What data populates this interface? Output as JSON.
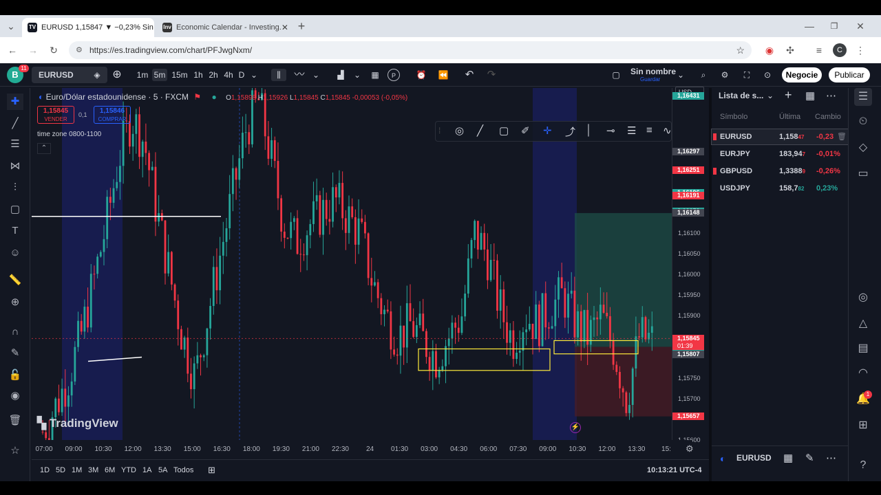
{
  "browser": {
    "tabs": [
      {
        "label": "EURUSD 1,15847 ▼ −0,23% Sin",
        "favicon": "TV"
      },
      {
        "label": "Economic Calendar - Investing.",
        "favicon": "Inv"
      }
    ],
    "url": "https://es.tradingview.com/chart/PFJwgNxm/",
    "profile_letter": "C"
  },
  "toolbar": {
    "user_badge": "B",
    "user_notifications": "11",
    "symbol": "EURUSD",
    "intervals": [
      "1m",
      "5m",
      "15m",
      "1h",
      "2h",
      "4h",
      "D"
    ],
    "active_interval": "5m",
    "layout_name": "Sin nombre",
    "layout_sub": "Guardar",
    "trade_button": "Negocie",
    "publish_button": "Publicar"
  },
  "chart": {
    "title": "Euro/Dólar estadounidense · 5 · FXCM",
    "ohlc": {
      "o_label": "O",
      "o": "1,15898",
      "h_label": "H",
      "h": "1,15926",
      "l_label": "L",
      "l": "1,15845",
      "c_label": "C",
      "c": "1,15845",
      "change": "-0,00053 (-0,05%)"
    },
    "sell_price": "1,15845",
    "sell_label": "VENDER",
    "spread": "0,1",
    "buy_price": "1,15846",
    "buy_label": "COMPRAR",
    "indicator_label": "time zone 0800-1100",
    "currency": "USD",
    "watermark": "TradingView",
    "countdown": "01:39"
  },
  "chart_data": {
    "type": "candlestick",
    "price_labels": [
      "1,16100",
      "1,16050",
      "1,16000",
      "1,15950",
      "1,15900",
      "1,15750",
      "1,15700",
      "1,15600"
    ],
    "price_values": [
      1.161,
      1.1605,
      1.16,
      1.1595,
      1.159,
      1.1575,
      1.157,
      1.156
    ],
    "price_badges": [
      {
        "text": "1,16431",
        "value": 1.16431,
        "color": "#26a69a"
      },
      {
        "text": "1,16297",
        "value": 1.16297,
        "color": "#434651"
      },
      {
        "text": "1,16251",
        "value": 1.16251,
        "color": "#f23645"
      },
      {
        "text": "1,16196",
        "value": 1.16196,
        "color": "#26a69a"
      },
      {
        "text": "1,16191",
        "value": 1.16191,
        "color": "#f23645"
      },
      {
        "text": "1,16152",
        "value": 1.16152,
        "color": "#26a69a"
      },
      {
        "text": "1,16148",
        "value": 1.16148,
        "color": "#434651"
      },
      {
        "text": "1,15845",
        "value": 1.15845,
        "color": "#f23645"
      },
      {
        "text": "1,15825",
        "value": 1.15825,
        "color": "#26a69a"
      },
      {
        "text": "1,15807",
        "value": 1.15807,
        "color": "#434651"
      },
      {
        "text": "1,15657",
        "value": 1.15657,
        "color": "#f23645"
      }
    ],
    "time_labels": [
      "07:00",
      "09:00",
      "10:30",
      "12:00",
      "13:30",
      "15:00",
      "16:30",
      "18:00",
      "19:30",
      "21:00",
      "22:30",
      "24",
      "01:30",
      "03:00",
      "04:30",
      "06:00",
      "07:30",
      "09:00",
      "10:30",
      "12:00",
      "13:30",
      "15:"
    ],
    "close_path": [
      1.1562,
      1.1568,
      1.1575,
      1.1585,
      1.1598,
      1.1612,
      1.1628,
      1.1638,
      1.1632,
      1.1615,
      1.16,
      1.1585,
      1.1575,
      1.159,
      1.1605,
      1.162,
      1.1635,
      1.1642,
      1.1628,
      1.1612,
      1.1608,
      1.1612,
      1.1615,
      1.1618,
      1.1614,
      1.161,
      1.1598,
      1.159,
      1.1585,
      1.1588,
      1.1584,
      1.158,
      1.1585,
      1.159,
      1.161,
      1.1605,
      1.1592,
      1.1584,
      1.159,
      1.1588,
      1.1592,
      1.1595,
      1.1588,
      1.1585,
      1.159,
      1.1582,
      1.157,
      1.1585,
      1.1584
    ],
    "current_price": 1.15845,
    "ylim": [
      1.156,
      1.1645
    ]
  },
  "watchlist": {
    "title": "Lista de s...",
    "col_symbol": "Símbolo",
    "col_last": "Última",
    "col_change": "Cambio",
    "rows": [
      {
        "symbol": "EURUSD",
        "last": "1,158",
        "last_small": "47",
        "change": "-0,23",
        "color": "#f23645"
      },
      {
        "symbol": "EURJPY",
        "last": "183,94",
        "last_small": "7",
        "change": "-0,01%",
        "color": "#f23645"
      },
      {
        "symbol": "GBPUSD",
        "last": "1,3388",
        "last_small": "9",
        "change": "-0,26%",
        "color": "#f23645"
      },
      {
        "symbol": "USDJPY",
        "last": "158,7",
        "last_small": "82",
        "change": "0,23%",
        "color": "#26a69a"
      }
    ],
    "bottom_symbol": "EURUSD"
  },
  "bottom_bar": {
    "ranges": [
      "1D",
      "5D",
      "1M",
      "3M",
      "6M",
      "YTD",
      "1A",
      "5A",
      "Todos"
    ],
    "clock": "10:13:21 UTC-4"
  },
  "right_rail": {
    "alert_badge": "1"
  }
}
